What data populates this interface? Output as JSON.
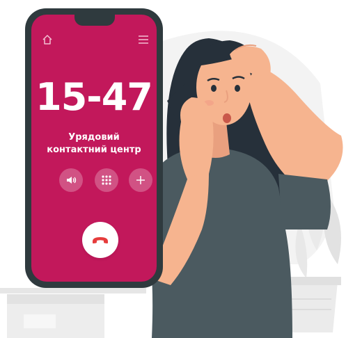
{
  "call_screen": {
    "number": "15-47",
    "caller_line1": "Урядовий",
    "caller_line2": "контактний центр"
  },
  "icons": {
    "home": "home-icon",
    "menu": "menu-icon",
    "speaker": "speaker-icon",
    "keypad": "keypad-icon",
    "add": "add-icon",
    "end_call": "phone-hangup-icon"
  },
  "colors": {
    "screen": "#c2185b",
    "phone_body": "#2f3a3e",
    "hangup_icon": "#e63c3c",
    "skin": "#f6b48f",
    "hair": "#26303a",
    "shirt": "#4b5a60"
  }
}
